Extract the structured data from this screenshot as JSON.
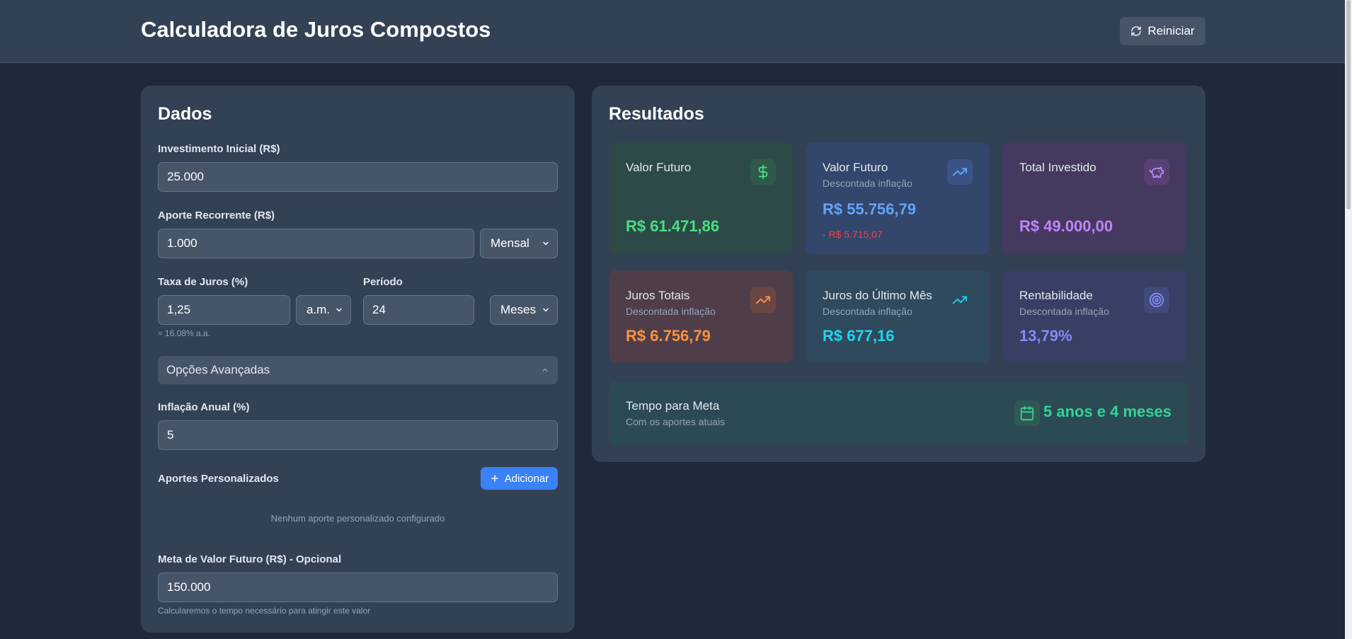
{
  "header": {
    "title": "Calculadora de Juros Compostos",
    "reset_label": "Reiniciar"
  },
  "inputs": {
    "title": "Dados",
    "initial_investment": {
      "label": "Investimento Inicial (R$)",
      "value": "25.000"
    },
    "recurring": {
      "label": "Aporte Recorrente (R$)",
      "value": "1.000",
      "frequency": "Mensal"
    },
    "interest": {
      "label": "Taxa de Juros (%)",
      "value": "1,25",
      "unit": "a.m.",
      "annual_hint": "≈ 16.08% a.a."
    },
    "period": {
      "label": "Período",
      "value": "24",
      "unit": "Meses"
    },
    "advanced": {
      "label": "Opções Avançadas"
    },
    "inflation": {
      "label": "Inflação Anual (%)",
      "value": "5"
    },
    "custom_contributions": {
      "label": "Aportes Personalizados",
      "add_label": "Adicionar",
      "empty_message": "Nenhum aporte personalizado configurado"
    },
    "goal": {
      "label": "Meta de Valor Futuro (R$) - Opcional",
      "value": "150.000",
      "hint": "Calcularemos o tempo necessário para atingir este valor"
    }
  },
  "results": {
    "title": "Resultados",
    "cards": [
      {
        "title": "Valor Futuro",
        "subtitle": "",
        "value": "R$ 61.471,86",
        "delta": "",
        "icon": "dollar-icon",
        "color": "#4ade80",
        "bg": "#2d4a48",
        "icon_bg": "#2f5a4a"
      },
      {
        "title": "Valor Futuro",
        "subtitle": "Descontada inflação",
        "value": "R$ 55.756,79",
        "delta": "- R$ 5.715,07",
        "icon": "trending-up-icon",
        "color": "#60a5fa",
        "bg": "#33466b",
        "icon_bg": "#3a5384"
      },
      {
        "title": "Total Investido",
        "subtitle": "",
        "value": "R$ 49.000,00",
        "delta": "",
        "icon": "piggy-bank-icon",
        "color": "#c084fc",
        "bg": "#45395f",
        "icon_bg": "#574172"
      },
      {
        "title": "Juros Totais",
        "subtitle": "Descontada inflação",
        "value": "R$ 6.756,79",
        "delta": "",
        "icon": "trending-up-icon",
        "color": "#fb923c",
        "bg": "#4f3e49",
        "icon_bg": "#6a4642"
      },
      {
        "title": "Juros do Último Mês",
        "subtitle": "Descontada inflação",
        "value": "R$ 677,16",
        "delta": "",
        "icon": "trending-up-icon",
        "color": "#22d3ee",
        "bg": "#2e4a5c",
        "icon_bg": "#2e4a5c"
      },
      {
        "title": "Rentabilidade",
        "subtitle": "Descontada inflação",
        "value": "13,79%",
        "delta": "",
        "icon": "target-icon",
        "color": "#818cf8",
        "bg": "#383f64",
        "icon_bg": "#414a7a"
      }
    ],
    "goal_time": {
      "title": "Tempo para Meta",
      "subtitle": "Com os aportes atuais",
      "value": "5 anos e 4 meses",
      "icon": "calendar-icon",
      "color": "#34d399"
    }
  }
}
